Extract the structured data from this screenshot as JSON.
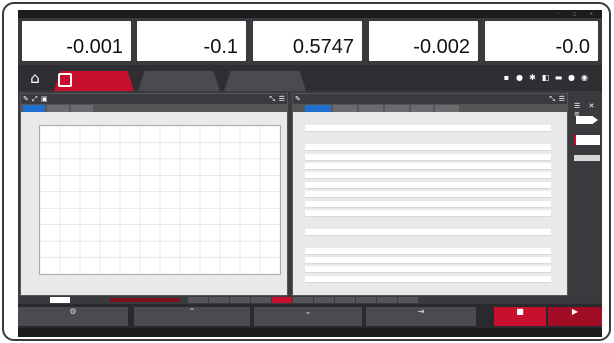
{
  "app": {
    "title": "",
    "window_controls": "–  □  ✕"
  },
  "readouts": [
    {
      "name": "",
      "unit": "",
      "value": "-0.001"
    },
    {
      "name": "",
      "unit": "",
      "value": "-0.1"
    },
    {
      "name": "",
      "unit": "",
      "value": "0.5747"
    },
    {
      "name": "",
      "unit": "",
      "value": "-0.002"
    },
    {
      "name": "",
      "unit": "",
      "value": "-0.0"
    }
  ],
  "nav": {
    "tabs": [
      {
        "label": ""
      },
      {
        "label": ""
      },
      {
        "label": ""
      }
    ]
  },
  "chart_panel": {
    "title": "",
    "subtabs": [
      "",
      "",
      ""
    ],
    "plot_caption": "",
    "xlabel": "",
    "ylabel": ""
  },
  "chart_data": {
    "type": "line",
    "title": "",
    "xlabel": "",
    "ylabel": "",
    "series": [],
    "grid": true
  },
  "table_panel": {
    "title": "",
    "subtabs": [
      "",
      "",
      "",
      "",
      "",
      ""
    ],
    "rows": [
      {
        "section": true,
        "label": ""
      },
      {
        "label": "",
        "value": "",
        "unit": ""
      },
      {
        "section": true,
        "label": ""
      },
      {
        "label": "",
        "value": "",
        "unit": ""
      },
      {
        "label": "",
        "value": "",
        "unit": ""
      },
      {
        "label": "",
        "value": "",
        "unit": ""
      },
      {
        "label": "",
        "value": "",
        "unit": ""
      },
      {
        "label": "",
        "value": "",
        "unit": ""
      },
      {
        "label": "",
        "value": "",
        "unit": ""
      },
      {
        "label": "",
        "value": "",
        "unit": ""
      },
      {
        "label": "",
        "value": "",
        "unit": ""
      },
      {
        "section": true,
        "label": ""
      },
      {
        "label": "",
        "value": "",
        "unit": ""
      },
      {
        "section": true,
        "label": ""
      },
      {
        "label": "",
        "value": "",
        "unit": ""
      },
      {
        "label": "",
        "value": "",
        "unit": ""
      },
      {
        "label": "",
        "value": "",
        "unit": ""
      },
      {
        "label": "",
        "value": "",
        "unit": ""
      }
    ]
  },
  "status_strip": {
    "label": "",
    "speed": "",
    "buttons": [
      "",
      "",
      "",
      "",
      "",
      "",
      "",
      "",
      "",
      "",
      ""
    ]
  },
  "bottom_buttons": [
    "",
    "",
    "",
    "",
    "",
    ""
  ],
  "footer": {
    "text": ""
  },
  "colors": {
    "accent": "#c8102e",
    "selected_tab": "#1f6fd1",
    "chrome": "#2c2c30"
  }
}
